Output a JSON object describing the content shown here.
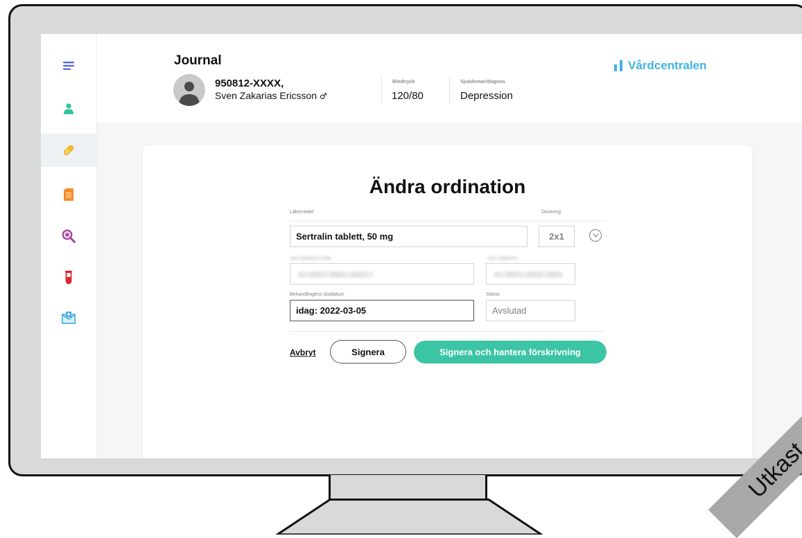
{
  "header": {
    "title": "Journal",
    "patient_id": "950812-XXXX,",
    "patient_name": "Sven Zakarias Ericsson",
    "gender_symbol": "♂",
    "blood_pressure_label": "Blodtryck",
    "blood_pressure_value": "120/80",
    "diagnosis_label": "Sjukdomar/diagnos",
    "diagnosis_value": "Depression",
    "brand_name": "Vårdcentralen"
  },
  "sidebar": {
    "items": [
      {
        "name": "menu",
        "icon": "menu-icon",
        "color": "#5b6bd6"
      },
      {
        "name": "patient",
        "icon": "person-icon",
        "color": "#33c2a0"
      },
      {
        "name": "medication",
        "icon": "pill-icon",
        "color": "#f4c542",
        "active": true
      },
      {
        "name": "documents",
        "icon": "document-icon",
        "color": "#f28c28"
      },
      {
        "name": "search",
        "icon": "magnifier-icon",
        "color": "#a0449a"
      },
      {
        "name": "lab",
        "icon": "test-tube-icon",
        "color": "#d9262c"
      },
      {
        "name": "messages",
        "icon": "medical-mail-icon",
        "color": "#3aa8e0"
      }
    ]
  },
  "form": {
    "title": "Ändra ordination",
    "medicine_label": "Läkemedel",
    "medicine_value": "Sertralin tablett, 50 mg",
    "dosage_label": "Dosering",
    "dosage_value": "2x1",
    "end_date_label": "Behandlingens slutdatum",
    "end_date_value": "idag: 2022-03-05",
    "status_label": "Status",
    "status_value": "Avslutad",
    "cancel_label": "Avbryt",
    "sign_label": "Signera",
    "sign_manage_label": "Signera och hantera förskrivning"
  },
  "draft_stamp": "Utkast",
  "colors": {
    "accent_green": "#3cc5a5",
    "brand_blue": "#3eb3e3"
  }
}
